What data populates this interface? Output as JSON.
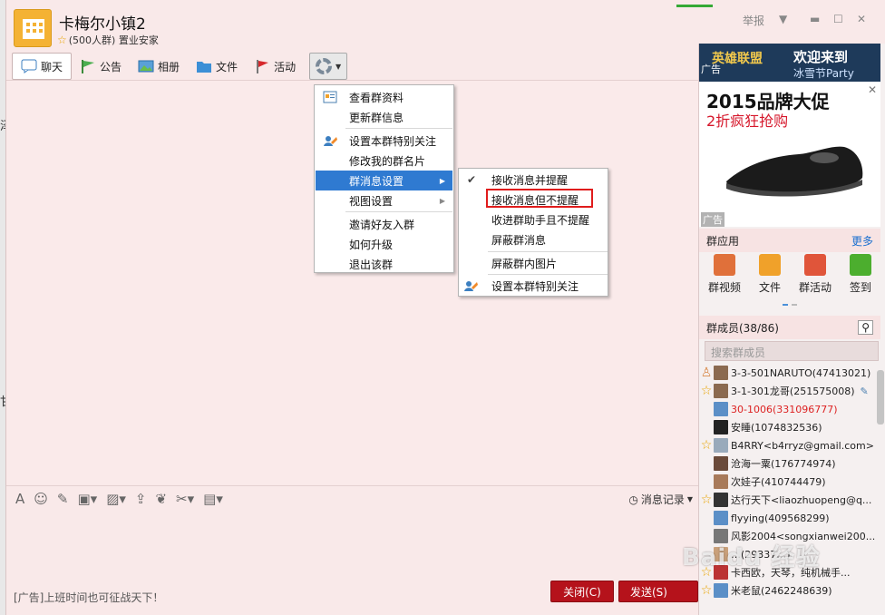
{
  "header": {
    "group_name": "卡梅尔小镇2",
    "group_sub": "(500人群) 置业安家",
    "report": "举报"
  },
  "tabs": [
    {
      "label": "聊天"
    },
    {
      "label": "公告"
    },
    {
      "label": "相册"
    },
    {
      "label": "文件"
    },
    {
      "label": "活动"
    }
  ],
  "menu": {
    "items": [
      {
        "label": "查看群资料"
      },
      {
        "label": "更新群信息"
      },
      {
        "label": "设置本群特别关注"
      },
      {
        "label": "修改我的群名片"
      },
      {
        "label": "群消息设置"
      },
      {
        "label": "视图设置"
      },
      {
        "label": "邀请好友入群"
      },
      {
        "label": "如何升级"
      },
      {
        "label": "退出该群"
      }
    ]
  },
  "submenu": {
    "items": [
      {
        "label": "接收消息并提醒",
        "checked": true
      },
      {
        "label": "接收消息但不提醒"
      },
      {
        "label": "收进群助手且不提醒"
      },
      {
        "label": "屏蔽群消息"
      },
      {
        "label": "屏蔽群内图片"
      },
      {
        "label": "设置本群特别关注"
      }
    ]
  },
  "input_toolbar": {
    "history": "消息记录"
  },
  "footer": {
    "ad_text": "[广告]上班时间也可征战天下！",
    "close": "关闭(C)",
    "send": "发送(S)"
  },
  "sidebar": {
    "banner_logo": "英雄联盟",
    "banner_title": "欢迎来到",
    "banner_sub": "冰雪节Party",
    "ad_label": "广告",
    "shoe_h1": "2015品牌大促",
    "shoe_h2": "2折疯狂抢购",
    "apps_title": "群应用",
    "apps_more": "更多",
    "apps": [
      {
        "label": "群视频",
        "color": "#e0703a"
      },
      {
        "label": "文件",
        "color": "#f0a12a"
      },
      {
        "label": "群活动",
        "color": "#e0553a"
      },
      {
        "label": "签到",
        "color": "#4cae2e"
      }
    ],
    "members_title": "群成员(38/86)",
    "search_placeholder": "搜索群成员",
    "members": [
      {
        "name": "3-3-501NARUTO(47413021)",
        "badge": "owner"
      },
      {
        "name": "3-1-301龙哥(251575008)",
        "badge": "star"
      },
      {
        "name": "30-1006(331096777)",
        "badge": "",
        "red": true
      },
      {
        "name": "安睡(1074832536)",
        "badge": ""
      },
      {
        "name": "B4RRY<b4rryz@gmail.com>",
        "badge": "star"
      },
      {
        "name": "沧海一粟(176774974)",
        "badge": ""
      },
      {
        "name": "次娃子(410744479)",
        "badge": ""
      },
      {
        "name": "达行天下<liaozhuopeng@q...",
        "badge": "star"
      },
      {
        "name": "flyying(409568299)",
        "badge": ""
      },
      {
        "name": "风影2004<songxianwei200...",
        "badge": ""
      },
      {
        "name": "…(29337…)",
        "badge": ""
      },
      {
        "name": "卡西欧，天琴，纯机械手...",
        "badge": "star"
      },
      {
        "name": "米老鼠(2462248639)",
        "badge": "star"
      }
    ]
  },
  "watermark": "Baidu 经验"
}
